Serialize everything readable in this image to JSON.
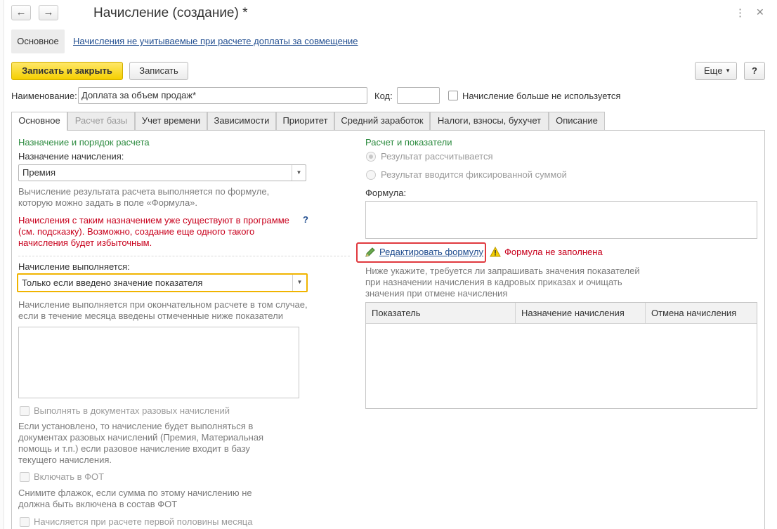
{
  "window": {
    "title": "Начисление (создание) *",
    "back_glyph": "←",
    "forward_glyph": "→",
    "more_glyph": "⋮",
    "maximize_glyph": "□",
    "close_glyph": "✕"
  },
  "nav_panel": {
    "active_item": "Основное",
    "link_item": "Начисления не учитываемые при расчете доплаты за совмещение"
  },
  "toolbar": {
    "save_close_label": "Записать и закрыть",
    "save_label": "Записать",
    "more_label": "Еще",
    "help_label": "?"
  },
  "header": {
    "name_label": "Наименование:",
    "name_value": "Доплата за объем продаж*",
    "code_label": "Код:",
    "code_value": "",
    "unused_label": "Начисление больше не используется"
  },
  "tabs": [
    {
      "label": "Основное",
      "state": "active"
    },
    {
      "label": "Расчет базы",
      "state": "disabled"
    },
    {
      "label": "Учет времени",
      "state": "normal"
    },
    {
      "label": "Зависимости",
      "state": "normal"
    },
    {
      "label": "Приоритет",
      "state": "normal"
    },
    {
      "label": "Средний заработок",
      "state": "normal"
    },
    {
      "label": "Налоги, взносы, бухучет",
      "state": "normal"
    },
    {
      "label": "Описание",
      "state": "normal"
    }
  ],
  "left": {
    "section_title": "Назначение и порядок расчета",
    "purpose_label": "Назначение начисления:",
    "purpose_value": "Премия",
    "formula_hint_line1": "Вычисление результата расчета выполняется по формуле,",
    "formula_hint_line2": "которую можно задать в поле «Формула».",
    "warning_line1": "Начисления с таким назначением уже существуют в программе",
    "warning_line2": "(см. подсказку). Возможно, создание еще одного такого",
    "warning_line3": "начисления будет избыточным.",
    "warning_help": "?",
    "exec_label": "Начисление выполняется:",
    "exec_value": "Только если введено значение показателя",
    "exec_hint_line1": "Начисление выполняется при окончательном расчете в том случае,",
    "exec_hint_line2": "если в течение месяца введены отмеченные ниже показатели",
    "onetime_label": "Выполнять в документах разовых начислений",
    "onetime_hint_line1": "Если установлено, то начисление будет выполняться в",
    "onetime_hint_line2": "документах разовых начислений (Премия, Материальная",
    "onetime_hint_line3": "помощь и т.п.) если разовое начисление входит в базу",
    "onetime_hint_line4": "текущего начисления.",
    "fot_label": "Включать в ФОТ",
    "fot_hint_line1": "Снимите флажок, если сумма по этому начислению не",
    "fot_hint_line2": "должна быть включена в состав ФОТ",
    "half_label": "Начисляется при расчете первой половины месяца"
  },
  "right": {
    "section_title": "Расчет и показатели",
    "radio_calculated": "Результат рассчитывается",
    "radio_fixed": "Результат вводится фиксированной суммой",
    "formula_label": "Формула:",
    "formula_value": "",
    "edit_formula_link": "Редактировать формулу",
    "formula_warning": "Формула не заполнена",
    "indicators_hint_line1": "Ниже укажите, требуется ли запрашивать значения показателей",
    "indicators_hint_line2": "при назначении начисления в кадровых приказах и очищать",
    "indicators_hint_line3": "значения при отмене начисления",
    "table_columns": [
      "Показатель",
      "Назначение начисления",
      "Отмена начисления"
    ]
  },
  "colors": {
    "accent_yellow": "#f5cf00",
    "section_green": "#2b8a3e",
    "warning_red": "#c8001c",
    "link_blue": "#1f4c8f",
    "highlight_red": "#e0393e",
    "focus_orange": "#f0b400"
  },
  "icons": {
    "pencil": "pencil-icon",
    "warning": "warning-triangle-icon"
  }
}
